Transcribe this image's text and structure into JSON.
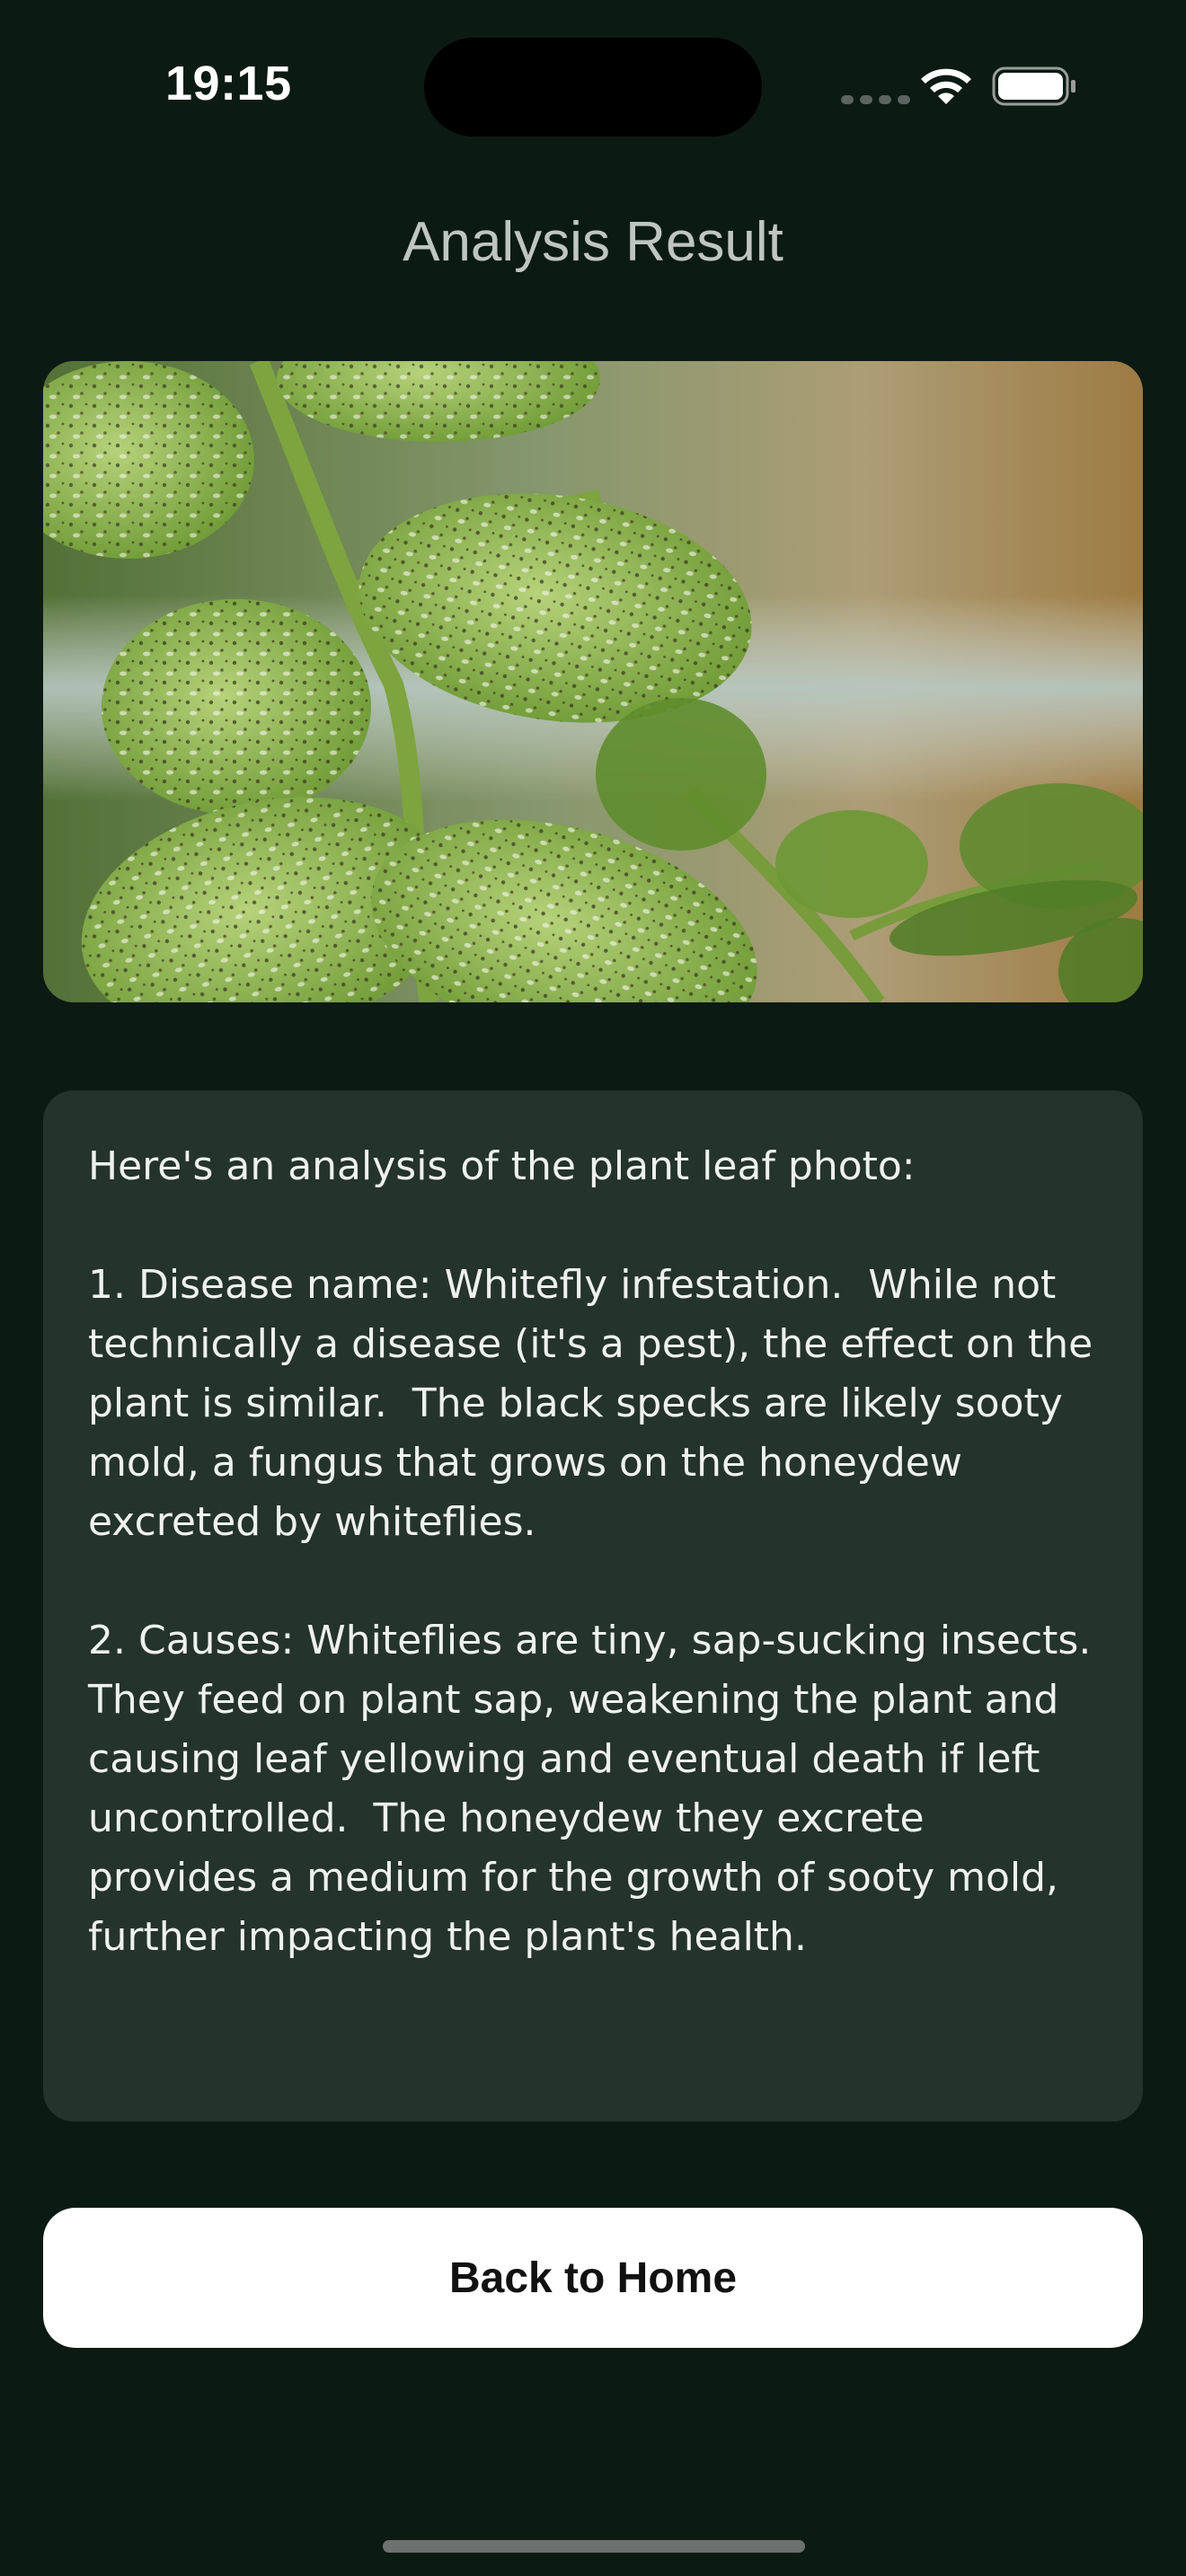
{
  "status_bar": {
    "time": "19:15",
    "icons": [
      "signal-dots-icon",
      "wifi-icon",
      "battery-icon"
    ]
  },
  "header": {
    "title": "Analysis Result"
  },
  "photo": {
    "subject": "leaf-photo"
  },
  "analysis": {
    "text": "Here's an analysis of the plant leaf photo:\n\n1. Disease name: Whitefly infestation.  While not technically a disease (it's a pest), the effect on the plant is similar.  The black specks are likely sooty mold, a fungus that grows on the honeydew excreted by whiteflies.\n\n2. Causes: Whiteflies are tiny, sap-sucking insects. They feed on plant sap, weakening the plant and causing leaf yellowing and eventual death if left uncontrolled.  The honeydew they excrete provides a medium for the growth of sooty mold, further impacting the plant's health."
  },
  "actions": {
    "back_label": "Back to Home"
  },
  "colors": {
    "background": "#0c1a14",
    "card": "#24332c",
    "title": "#bfc6c2",
    "button": "#ffffff"
  }
}
